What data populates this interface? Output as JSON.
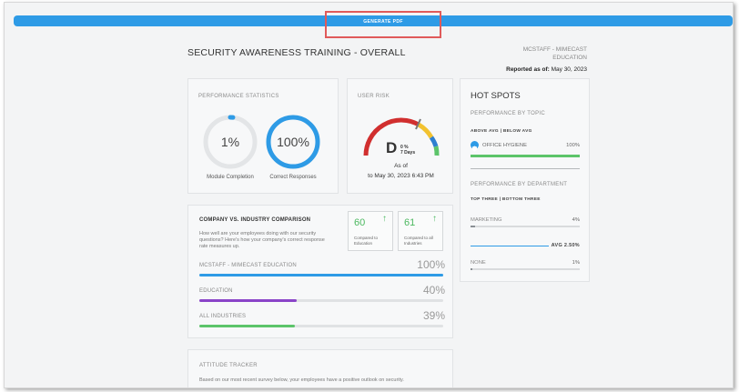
{
  "toolbar": {
    "generate_pdf_label": "GENERATE PDF"
  },
  "header": {
    "title": "SECURITY AWARENESS TRAINING - OVERALL",
    "org_line1": "MCSTAFF - MIMECAST",
    "org_line2": "EDUCATION",
    "reported_label": "Reported as of:",
    "reported_date": "May 30, 2023"
  },
  "performance": {
    "label": "PERFORMANCE STATISTICS",
    "module_completion": {
      "value": "1%",
      "caption": "Module Completion",
      "fraction": 0.01
    },
    "correct_responses": {
      "value": "100%",
      "caption": "Correct Responses",
      "fraction": 1.0
    }
  },
  "user_risk": {
    "label": "USER RISK",
    "grade": "D",
    "change": "0 %",
    "period": "7 Days",
    "as_of_label": "As of",
    "as_of_date": "to May 30, 2023 6:43 PM"
  },
  "hot_spots": {
    "title": "HOT SPOTS",
    "topic_label": "PERFORMANCE BY TOPIC",
    "topic_toggle": "ABOVE AVG | BELOW AVG",
    "topic_item": {
      "label": "OFFICE HYGIENE",
      "value": "100%",
      "fraction": 1.0
    },
    "department_label": "PERFORMANCE BY DEPARTMENT",
    "department_toggle": "TOP THREE | BOTTOM THREE",
    "departments": [
      {
        "label": "MARKETING",
        "value": "4%",
        "fraction": 0.04
      },
      {
        "label": "NONE",
        "value": "1%",
        "fraction": 0.01
      }
    ],
    "avg_label": "AVG 2.50%"
  },
  "comparison": {
    "title": "COMPANY VS. INDUSTRY COMPARISON",
    "description": "How well are your employees doing with our security questions? Here's how your company's correct response rate measures up.",
    "cards": [
      {
        "value": "60",
        "caption": "Compared to Education"
      },
      {
        "value": "61",
        "caption": "Compared to all Industries"
      }
    ],
    "bars": [
      {
        "label": "MCSTAFF - MIMECAST EDUCATION",
        "value": "100%",
        "fraction": 1.0,
        "color": "#2e9be6"
      },
      {
        "label": "EDUCATION",
        "value": "40%",
        "fraction": 0.4,
        "color": "#8a44c8"
      },
      {
        "label": "ALL INDUSTRIES",
        "value": "39%",
        "fraction": 0.39,
        "color": "#5cc46a"
      }
    ]
  },
  "attitude": {
    "title": "ATTITUDE TRACKER",
    "description": "Based on our most recent survey below, your employees have a positive outlook on security."
  },
  "colors": {
    "accent": "#2e9be6",
    "positive": "#4cb860"
  },
  "icons": {
    "topic_icon": "shield-icon",
    "arrow_up": "arrow-up-icon"
  }
}
